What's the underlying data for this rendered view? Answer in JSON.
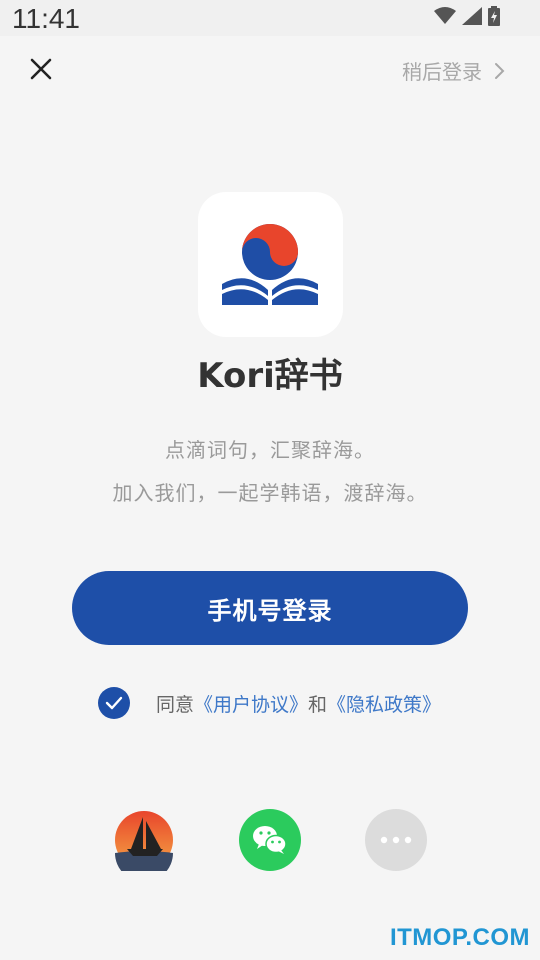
{
  "status_bar": {
    "time": "11:41",
    "icons": [
      "wifi-icon",
      "signal-icon",
      "battery-icon"
    ]
  },
  "header": {
    "close_icon": "close-icon",
    "later_label": "稍后登录",
    "later_icon": "chevron-right-icon"
  },
  "app": {
    "name": "Kori辞书",
    "logo_icon": "kori-book-logo",
    "slogan_line1": "点滴词句，汇聚辞海。",
    "slogan_line2": "加入我们，一起学韩语，渡辞海。"
  },
  "login": {
    "phone_login_label": "手机号登录"
  },
  "agreement": {
    "checked": true,
    "prefix": "同意",
    "user_agreement": "《用户协议》",
    "conjunction": "和",
    "privacy_policy": "《隐私政策》"
  },
  "social_login": {
    "items": [
      "sailboat-app-icon",
      "wechat-icon",
      "more-icon"
    ]
  },
  "watermark": "ITMOP.COM",
  "colors": {
    "primary": "#1e4fa8",
    "link": "#3e78c8",
    "wechat": "#2bcb5d",
    "background": "#f5f5f5"
  }
}
